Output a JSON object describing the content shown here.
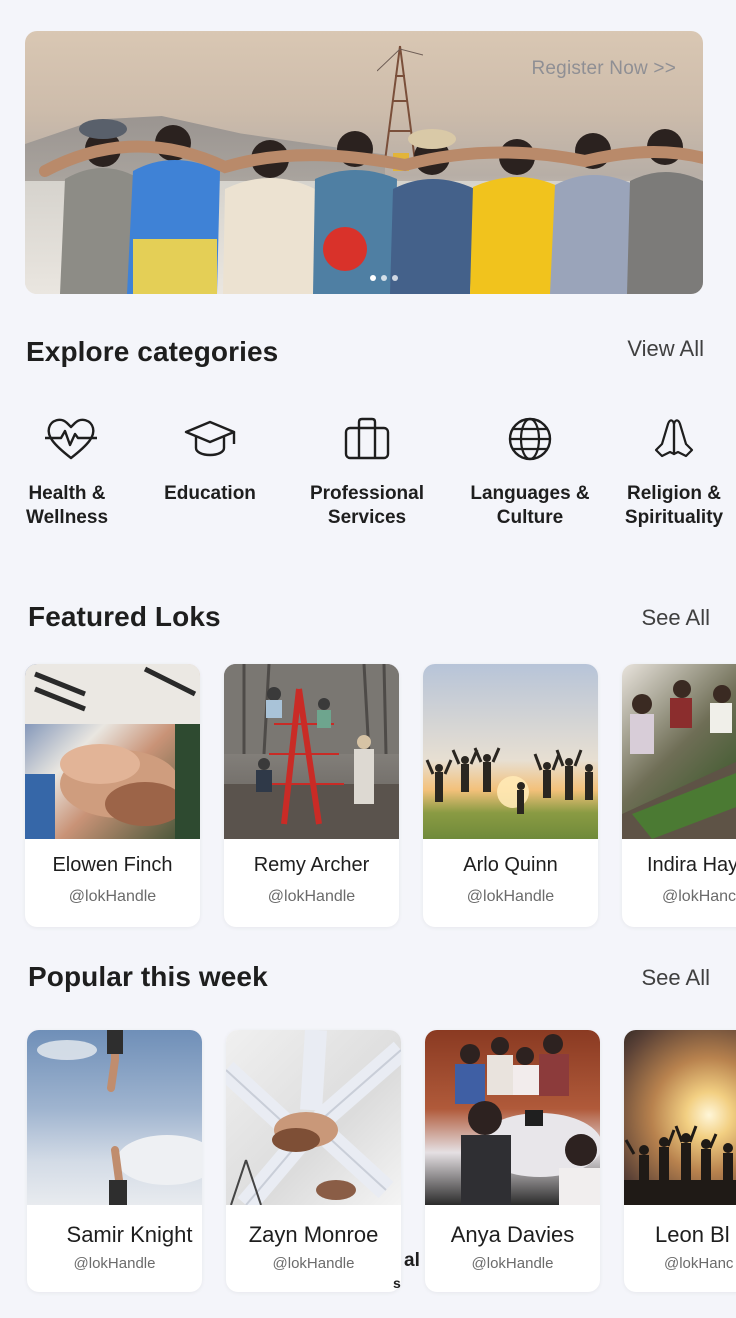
{
  "hero": {
    "register_label": "Register Now >>",
    "carousel_pages": 3,
    "active_page": 1
  },
  "categories": {
    "title": "Explore categories",
    "view_all_label": "View All",
    "items": [
      {
        "label": "Health & Wellness",
        "icon": "heart-pulse-icon"
      },
      {
        "label": "Education",
        "icon": "graduation-cap-icon"
      },
      {
        "label": "Professional Services",
        "icon": "briefcase-icon"
      },
      {
        "label": "Languages & Culture",
        "icon": "globe-icon"
      },
      {
        "label": "Religion & Spirituality",
        "icon": "praying-hands-icon"
      }
    ]
  },
  "featured": {
    "title": "Featured Loks",
    "see_all_label": "See All",
    "cards": [
      {
        "name": "Elowen Finch",
        "handle": "@lokHandle"
      },
      {
        "name": "Remy Archer",
        "handle": "@lokHandle"
      },
      {
        "name": "Arlo Quinn",
        "handle": "@lokHandle"
      },
      {
        "name": "Indira Hay",
        "handle": "@lokHanc"
      }
    ]
  },
  "popular": {
    "title": "Popular this week",
    "see_all_label": "See All",
    "cards": [
      {
        "name": "Samir Knight",
        "handle": "@lokHandle"
      },
      {
        "name": "Zayn Monroe",
        "handle": "@lokHandle"
      },
      {
        "name": "Anya Davies",
        "handle": "@lokHandle"
      },
      {
        "name": "Leon Bl",
        "handle": "@lokHanc"
      }
    ]
  },
  "stray_text": {
    "a": "al",
    "b": "s"
  }
}
